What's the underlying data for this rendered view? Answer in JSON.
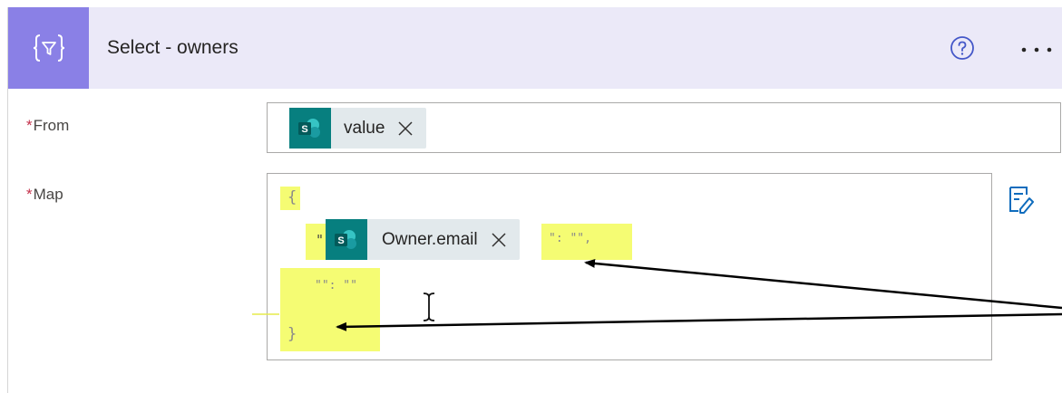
{
  "action": {
    "title": "Select - owners",
    "icon": "select-data-operation-icon",
    "accent_color": "#8a80e6",
    "header_background": "#ebe9f8"
  },
  "header_buttons": {
    "help_icon": "question-circle-icon",
    "more_icon": "ellipsis-icon"
  },
  "fields": {
    "from": {
      "required_mark": "*",
      "label": "From",
      "token": {
        "label": "value",
        "icon": "sharepoint-icon"
      }
    },
    "map": {
      "required_mark": "*",
      "label": "Map",
      "open_brace": "{",
      "quote_open": "\"",
      "token": {
        "label": "Owner.email",
        "icon": "sharepoint-icon"
      },
      "after_token": "\": \"\",",
      "empty_pair": "\"\": \"\"",
      "close_brace": "}",
      "switch_mode_icon": "switch-to-text-mode-icon"
    }
  },
  "annotation": {
    "highlight_color": "#f5fc73",
    "arrows_pointing_to": [
      "after-token-text",
      "close-brace"
    ]
  }
}
